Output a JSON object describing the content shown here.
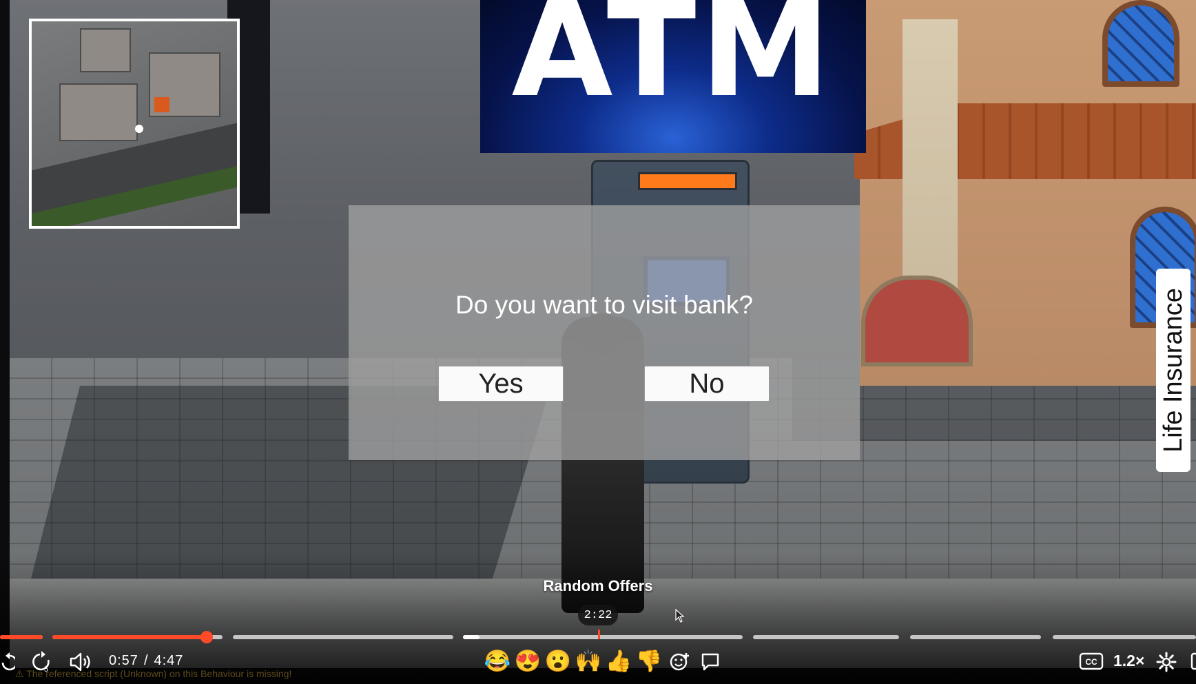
{
  "scene": {
    "atm_sign": "ATM",
    "side_tab": "Life Insurance",
    "minimap_label": "minimap"
  },
  "dialog": {
    "question": "Do you want to visit bank?",
    "yes_label": "Yes",
    "no_label": "No"
  },
  "player": {
    "chapter_title": "Random Offers",
    "hover_time": "2:22",
    "current_time": "0:57",
    "separator": "/",
    "duration": "4:47",
    "playback_speed": "1.2×",
    "captions_label": "CC",
    "progress_fraction": 0.199,
    "console_message": "⚠ The referenced script (Unknown) on this Behaviour is missing!",
    "reactions": [
      "😂",
      "😍",
      "😮",
      "🙌",
      "👍",
      "👎"
    ],
    "accent_color": "#ff4a2a"
  }
}
